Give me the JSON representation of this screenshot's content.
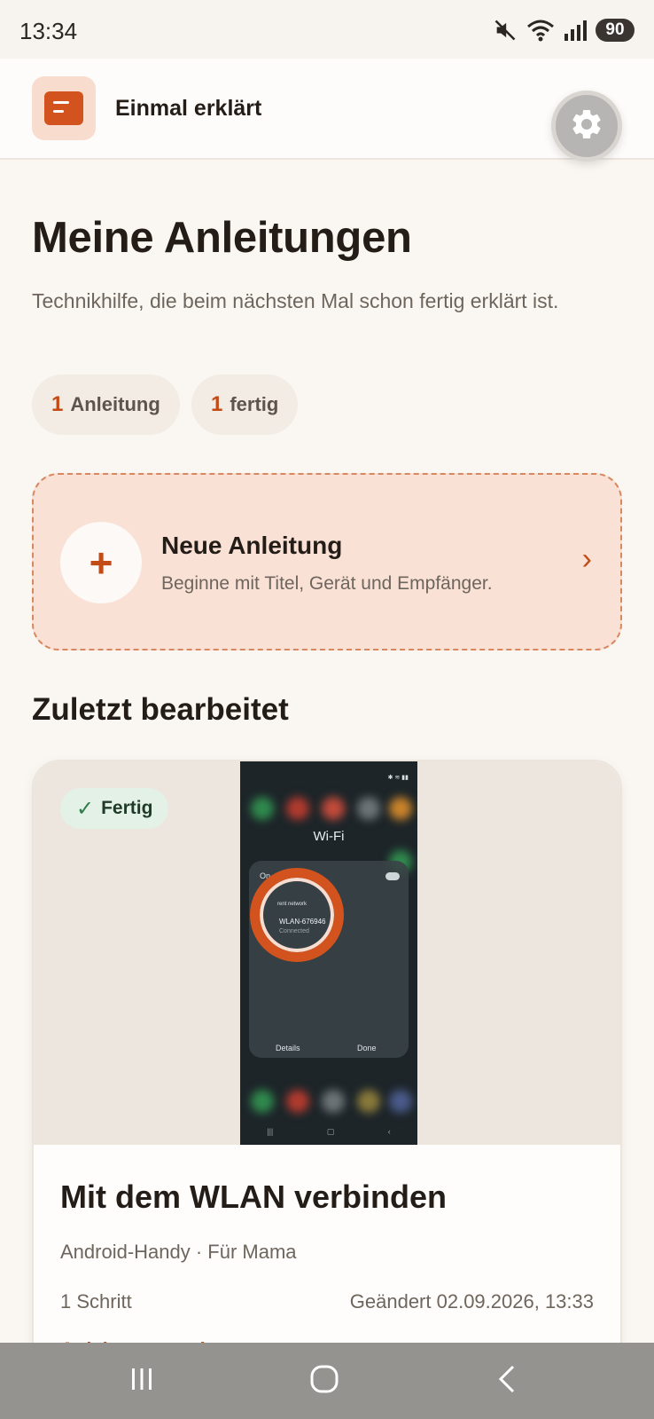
{
  "status_bar": {
    "time": "13:34",
    "battery": "90"
  },
  "header": {
    "app_name": "Einmal erklärt"
  },
  "main": {
    "title": "Meine Anleitungen",
    "subtitle": "Technikhilfe, die beim nächsten Mal schon fertig erklärt ist.",
    "stats": [
      {
        "count": "1",
        "label": "Anleitung"
      },
      {
        "count": "1",
        "label": "fertig"
      }
    ],
    "new_guide": {
      "title": "Neue Anleitung",
      "description": "Beginne mit Titel, Gerät und Empfänger.",
      "plus": "+",
      "chevron": "›"
    },
    "recent_section": "Zuletzt bearbeitet",
    "recent": {
      "status": "Fertig",
      "status_check": "✓",
      "title": "Mit dem WLAN verbinden",
      "meta": "Android-Handy · Für Mama",
      "steps": "1 Schritt",
      "updated": "Geändert 02.09.2026, 13:33",
      "action": "Anleitung ansehen",
      "screenshot": {
        "title": "Wi-Fi",
        "toggle_label": "On",
        "current_network_label": "rent network",
        "network_name": "WLAN-676946",
        "network_status": "Connected",
        "details": "Details",
        "done": "Done"
      }
    }
  },
  "colors": {
    "accent": "#c34b16",
    "background": "#faf7f2",
    "new_card": "#f9e1d6",
    "success_chip": "#e3f1e6",
    "highlight_ring": "#d2531d"
  },
  "icons": [
    "mute-icon",
    "wifi-icon",
    "signal-icon",
    "book-icon",
    "gear-icon",
    "plus-icon",
    "chevron-right-icon",
    "check-icon",
    "recents-icon",
    "home-icon",
    "back-icon"
  ]
}
